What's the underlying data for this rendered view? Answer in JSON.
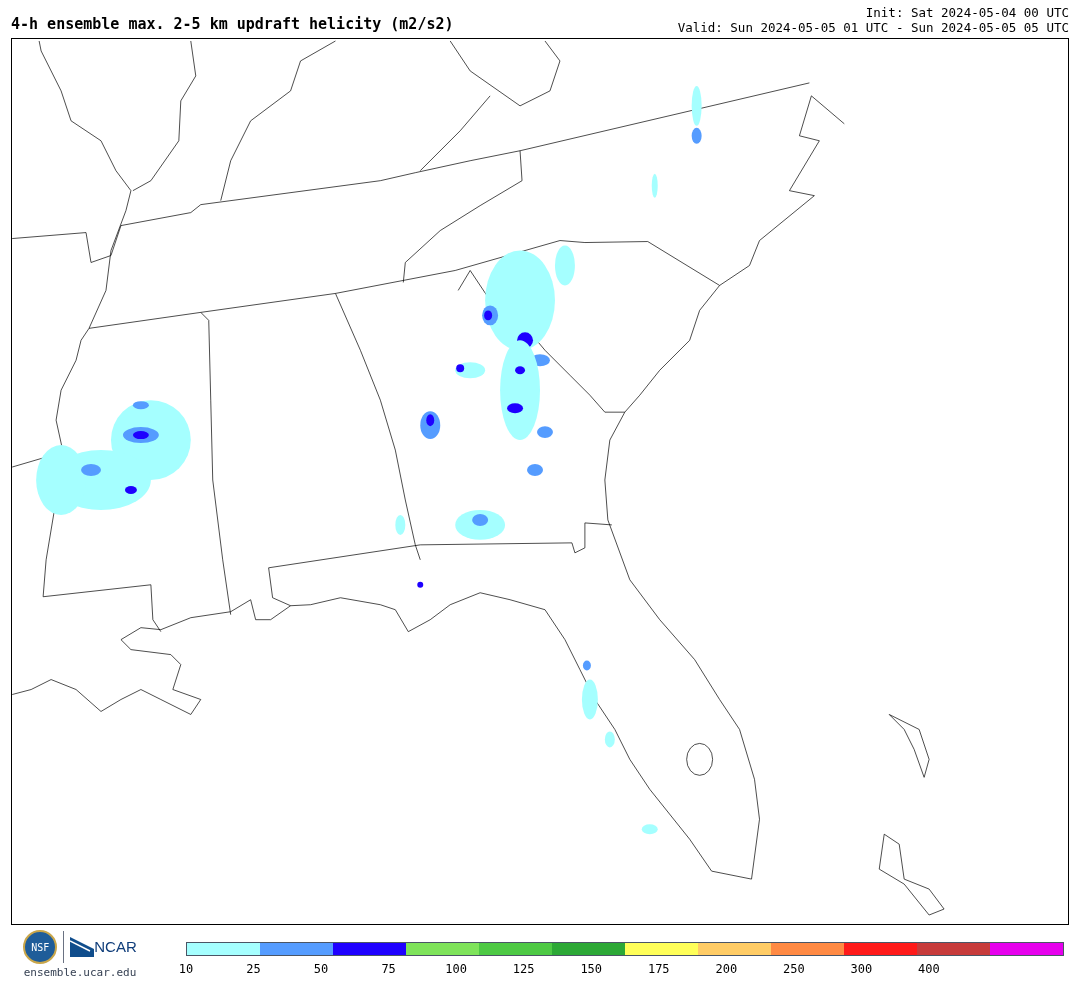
{
  "title": "4-h ensemble max. 2-5 km updraft helicity (m2/s2)",
  "init": "Init: Sat 2024-05-04 00 UTC",
  "valid": "Valid: Sun 2024-05-05 01 UTC - Sun 2024-05-05 05 UTC",
  "logos": {
    "nsf": "NSF",
    "ncar": "NCAR"
  },
  "site": "ensemble.ucar.edu",
  "legend": {
    "segments": [
      {
        "color": "#a5ffff"
      },
      {
        "color": "#559cff"
      },
      {
        "color": "#1e00ff"
      },
      {
        "color": "#7ee35a"
      },
      {
        "color": "#4dc944"
      },
      {
        "color": "#2ca836"
      },
      {
        "color": "#ffff59"
      },
      {
        "color": "#ffcc66"
      },
      {
        "color": "#ff8a44"
      },
      {
        "color": "#ff1a1a"
      },
      {
        "color": "#c73b3b"
      },
      {
        "color": "#e600ed"
      }
    ],
    "ticks": [
      "10",
      "25",
      "50",
      "75",
      "100",
      "125",
      "150",
      "175",
      "200",
      "250",
      "300",
      "400"
    ]
  }
}
